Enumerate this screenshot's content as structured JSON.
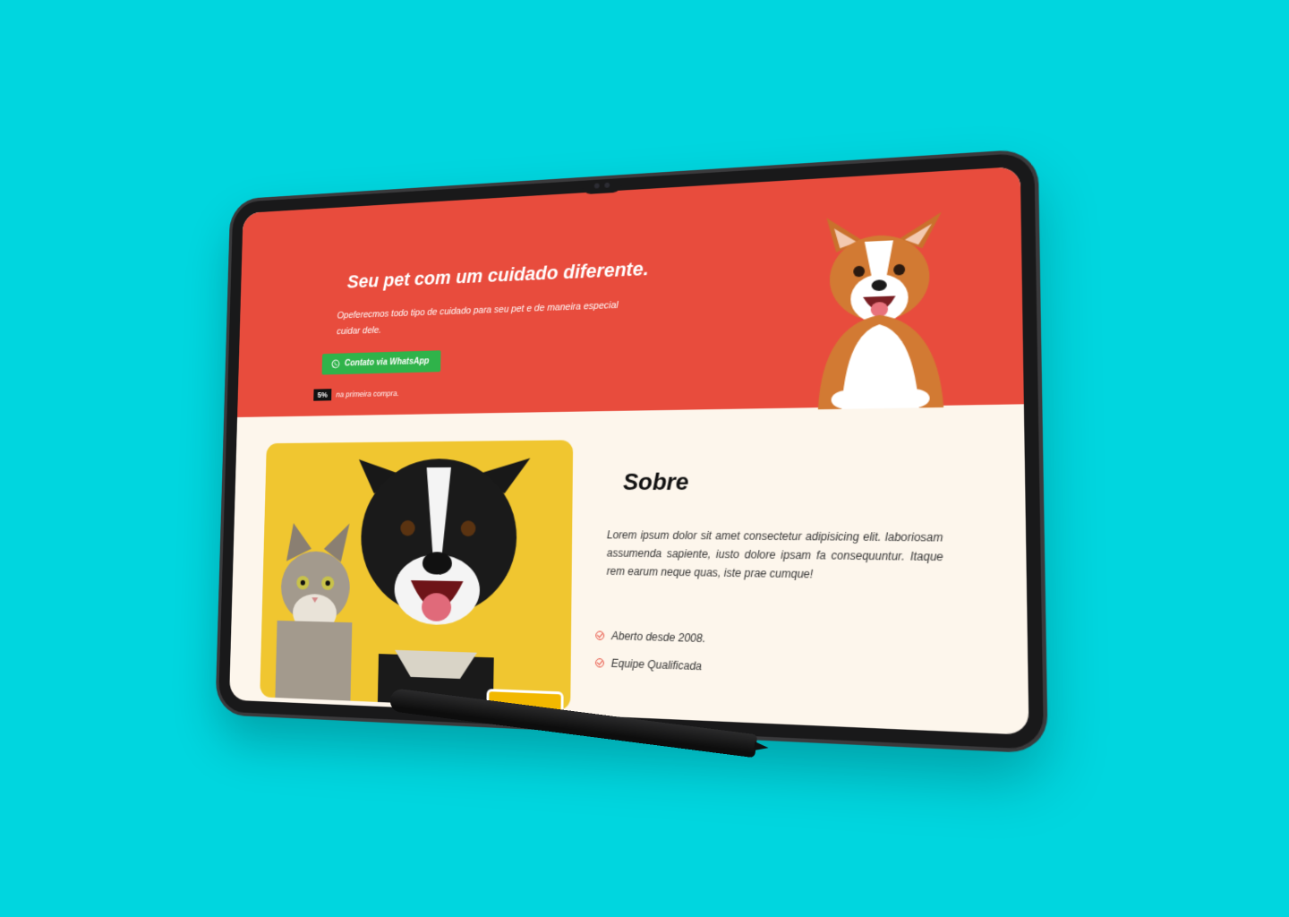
{
  "hero": {
    "title": "Seu pet com um cuidado diferente.",
    "description": "Opeferecmos todo tipo de cuidado para seu pet e de maneira especial cuidar dele.",
    "cta_label": "Contato via WhatsApp",
    "promo_badge": "5%",
    "promo_text": "na primeira compra."
  },
  "about": {
    "title": "Sobre",
    "text": "Lorem ipsum dolor sit amet consectetur adipisicing elit. laboriosam assumenda sapiente, iusto dolore ipsam fa consequuntur. Itaque rem earum neque quas, iste prae cumque!",
    "features": [
      "Aberto desde 2008.",
      "Equipe Qualificada"
    ]
  },
  "colors": {
    "background": "#00d6df",
    "hero": "#e84c3d",
    "whatsapp": "#2fb34a",
    "page": "#fdf6ec",
    "photo_bg": "#f0c630"
  }
}
